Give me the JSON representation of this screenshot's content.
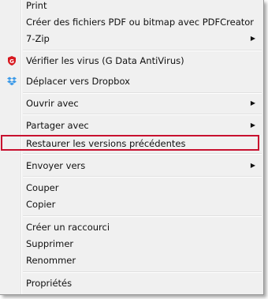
{
  "menu": {
    "items": [
      {
        "label": "Print",
        "arrow": ""
      },
      {
        "label": "Créer des fichiers PDF ou bitmap avec PDFCreator",
        "arrow": ""
      },
      {
        "label": "7-Zip",
        "arrow": "▶"
      },
      {
        "label": "Vérifier les virus (G Data AntiVirus)",
        "arrow": "",
        "icon": "gdata-shield-icon"
      },
      {
        "label": "Déplacer vers Dropbox",
        "arrow": "",
        "icon": "dropbox-icon"
      },
      {
        "label": "Ouvrir avec",
        "arrow": "▶"
      },
      {
        "label": "Partager avec",
        "arrow": "▶"
      },
      {
        "label": "Restaurer les versions précédentes",
        "arrow": "",
        "highlighted": true
      },
      {
        "label": "Envoyer vers",
        "arrow": "▶"
      },
      {
        "label": "Couper",
        "arrow": ""
      },
      {
        "label": "Copier",
        "arrow": ""
      },
      {
        "label": "Créer un raccourci",
        "arrow": ""
      },
      {
        "label": "Supprimer",
        "arrow": ""
      },
      {
        "label": "Renommer",
        "arrow": ""
      },
      {
        "label": "Propriétés",
        "arrow": ""
      }
    ]
  },
  "colors": {
    "menu_bg": "#f0f0f0",
    "highlight_border": "#c8102e",
    "gdata_red": "#d71920",
    "dropbox_blue": "#3d9ae8"
  }
}
